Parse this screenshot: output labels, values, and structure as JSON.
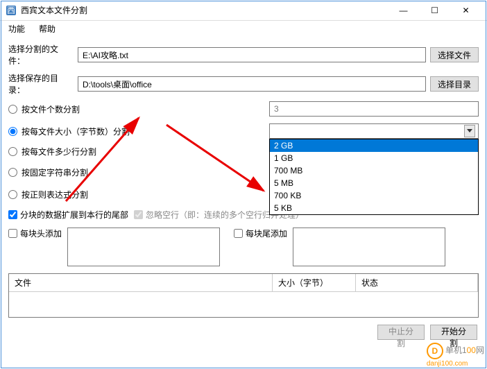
{
  "window": {
    "title": "西宾文本文件分割",
    "min": "—",
    "max": "☐",
    "close": "✕"
  },
  "menu": {
    "func": "功能",
    "help": "帮助"
  },
  "labels": {
    "selectFile": "选择分割的文件：",
    "selectDir": "选择保存的目录：",
    "browseFile": "选择文件",
    "browseDir": "选择目录"
  },
  "inputs": {
    "file": "E:\\AI攻略.txt",
    "dir": "D:\\tools\\桌面\\office",
    "count": "3"
  },
  "radios": {
    "byCount": "按文件个数分割",
    "bySize": "按每文件大小（字节数）分割",
    "byLines": "按每文件多少行分割",
    "byString": "按固定字符串分割",
    "byRegex": "按正则表达式分割"
  },
  "dropdown": {
    "options": [
      "2 GB",
      "1 GB",
      "700 MB",
      "5 MB",
      "700 KB",
      "5 KB"
    ],
    "selected": "2 GB"
  },
  "checks": {
    "extendTail": "分块的数据扩展到本行的尾部",
    "skipEmpty": "忽略空行（即：连续的多个空行归并处理）",
    "headAdd": "每块头添加",
    "tailAdd": "每块尾添加"
  },
  "table": {
    "col1": "文件",
    "col2": "大小（字节）",
    "col3": "状态"
  },
  "buttons": {
    "stop": "中止分割",
    "start": "开始分割"
  },
  "watermark": {
    "t1": "单机1",
    "t2": "00",
    "t3": "网",
    "url": "danji100.com"
  }
}
